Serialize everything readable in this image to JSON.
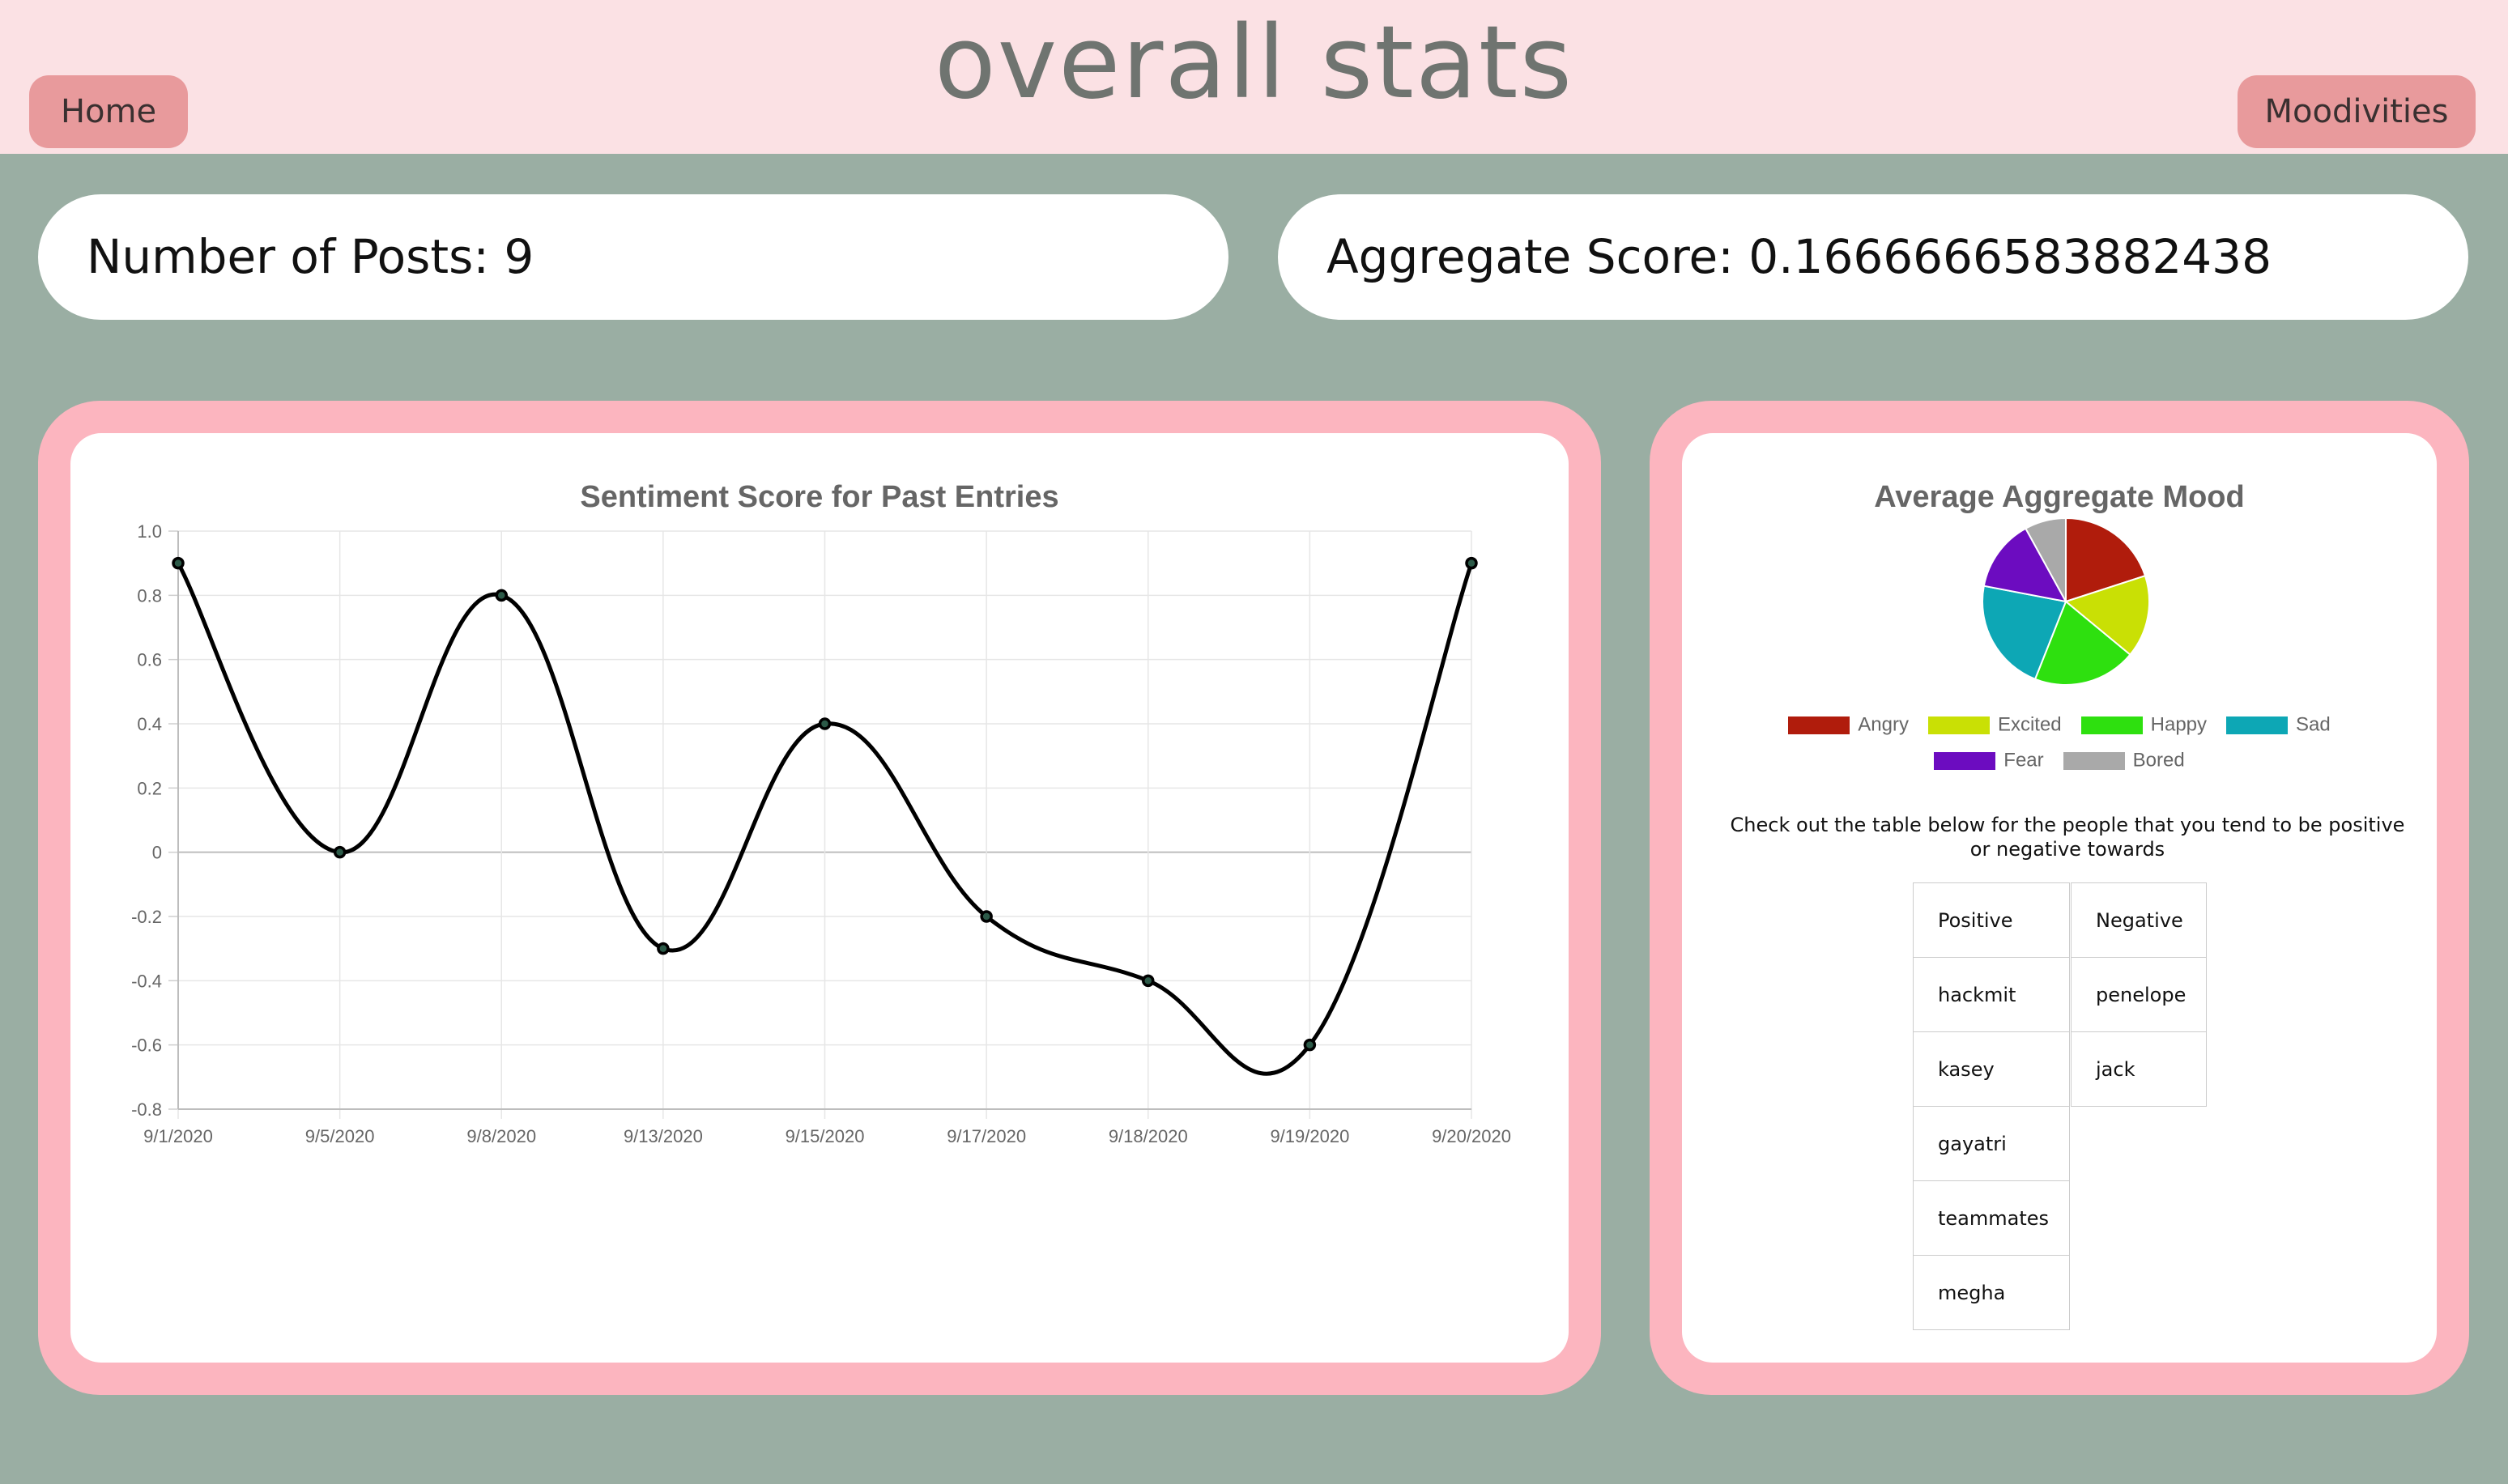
{
  "header": {
    "title": "overall stats",
    "home_label": "Home",
    "moodivities_label": "Moodivities"
  },
  "stats": {
    "posts_text": "Number of Posts: 9",
    "aggregate_text": "Aggregate Score: 0.1666666583882438"
  },
  "chart_data": [
    {
      "type": "line",
      "title": "Sentiment Score for Past Entries",
      "categories": [
        "9/1/2020",
        "9/5/2020",
        "9/8/2020",
        "9/13/2020",
        "9/15/2020",
        "9/17/2020",
        "9/18/2020",
        "9/19/2020",
        "9/20/2020"
      ],
      "values": [
        0.9,
        0.0,
        0.8,
        -0.3,
        0.4,
        -0.2,
        -0.4,
        -0.6,
        0.9
      ],
      "ylim": [
        -0.8,
        1.0
      ],
      "yticks": [
        "1.0",
        "0.8",
        "0.6",
        "0.4",
        "0.2",
        "0",
        "-0.2",
        "-0.4",
        "-0.6",
        "-0.8"
      ],
      "grid": true,
      "line_color": "#000000"
    },
    {
      "type": "pie",
      "title": "Average Aggregate Mood",
      "series": [
        {
          "name": "Angry",
          "value": 0.2,
          "color": "#b01c0c"
        },
        {
          "name": "Excited",
          "value": 0.16,
          "color": "#c9e005"
        },
        {
          "name": "Happy",
          "value": 0.2,
          "color": "#2ee00f"
        },
        {
          "name": "Sad",
          "value": 0.22,
          "color": "#0da7b5"
        },
        {
          "name": "Fear",
          "value": 0.14,
          "color": "#6c0cc0"
        },
        {
          "name": "Bored",
          "value": 0.08,
          "color": "#a9a9a9"
        }
      ],
      "legend_position": "bottom"
    }
  ],
  "people": {
    "caption": "Check out the table below for the people that you tend to be positive or negative towards",
    "positive_header": "Positive",
    "negative_header": "Negative",
    "positive": [
      "hackmit",
      "kasey",
      "gayatri",
      "teammates",
      "megha"
    ],
    "negative": [
      "penelope",
      "jack"
    ]
  }
}
